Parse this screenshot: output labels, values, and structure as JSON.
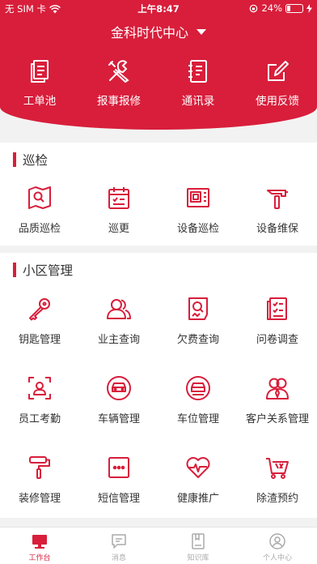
{
  "status_bar": {
    "carrier": "无 SIM 卡",
    "time": "上午8:47",
    "battery": "24%",
    "battery_level": 0.24
  },
  "location": {
    "name": "金科时代中心"
  },
  "quick_actions": [
    {
      "label": "工单池",
      "icon": "clipboard-icon"
    },
    {
      "label": "报事报修",
      "icon": "tools-icon"
    },
    {
      "label": "通讯录",
      "icon": "address-book-icon"
    },
    {
      "label": "使用反馈",
      "icon": "edit-icon"
    }
  ],
  "patrol": {
    "title": "巡检",
    "items": [
      {
        "label": "品质巡检",
        "icon": "map-search-icon"
      },
      {
        "label": "巡更",
        "icon": "calendar-check-icon"
      },
      {
        "label": "设备巡检",
        "icon": "device-panel-icon"
      },
      {
        "label": "设备维保",
        "icon": "hammer-icon"
      }
    ]
  },
  "community": {
    "title": "小区管理",
    "items": [
      {
        "label": "钥匙管理",
        "icon": "key-icon"
      },
      {
        "label": "业主查询",
        "icon": "users-icon"
      },
      {
        "label": "欠费查询",
        "icon": "bill-search-icon"
      },
      {
        "label": "问卷调查",
        "icon": "survey-icon"
      },
      {
        "label": "员工考勤",
        "icon": "face-scan-icon"
      },
      {
        "label": "车辆管理",
        "icon": "car-icon"
      },
      {
        "label": "车位管理",
        "icon": "parking-icon"
      },
      {
        "label": "客户关系管理",
        "icon": "client-icon"
      },
      {
        "label": "装修管理",
        "icon": "paint-roller-icon"
      },
      {
        "label": "短信管理",
        "icon": "sms-icon"
      },
      {
        "label": "健康推广",
        "icon": "heart-pulse-icon"
      },
      {
        "label": "除渣预约",
        "icon": "cart-icon"
      }
    ]
  },
  "tabs": [
    {
      "label": "工作台",
      "icon": "desktop-icon",
      "active": true
    },
    {
      "label": "消息",
      "icon": "message-icon",
      "active": false
    },
    {
      "label": "知识库",
      "icon": "book-icon",
      "active": false
    },
    {
      "label": "个人中心",
      "icon": "user-icon",
      "active": false
    }
  ],
  "colors": {
    "brand": "#d81e3b",
    "inactive_tab": "#aaaaaa"
  }
}
